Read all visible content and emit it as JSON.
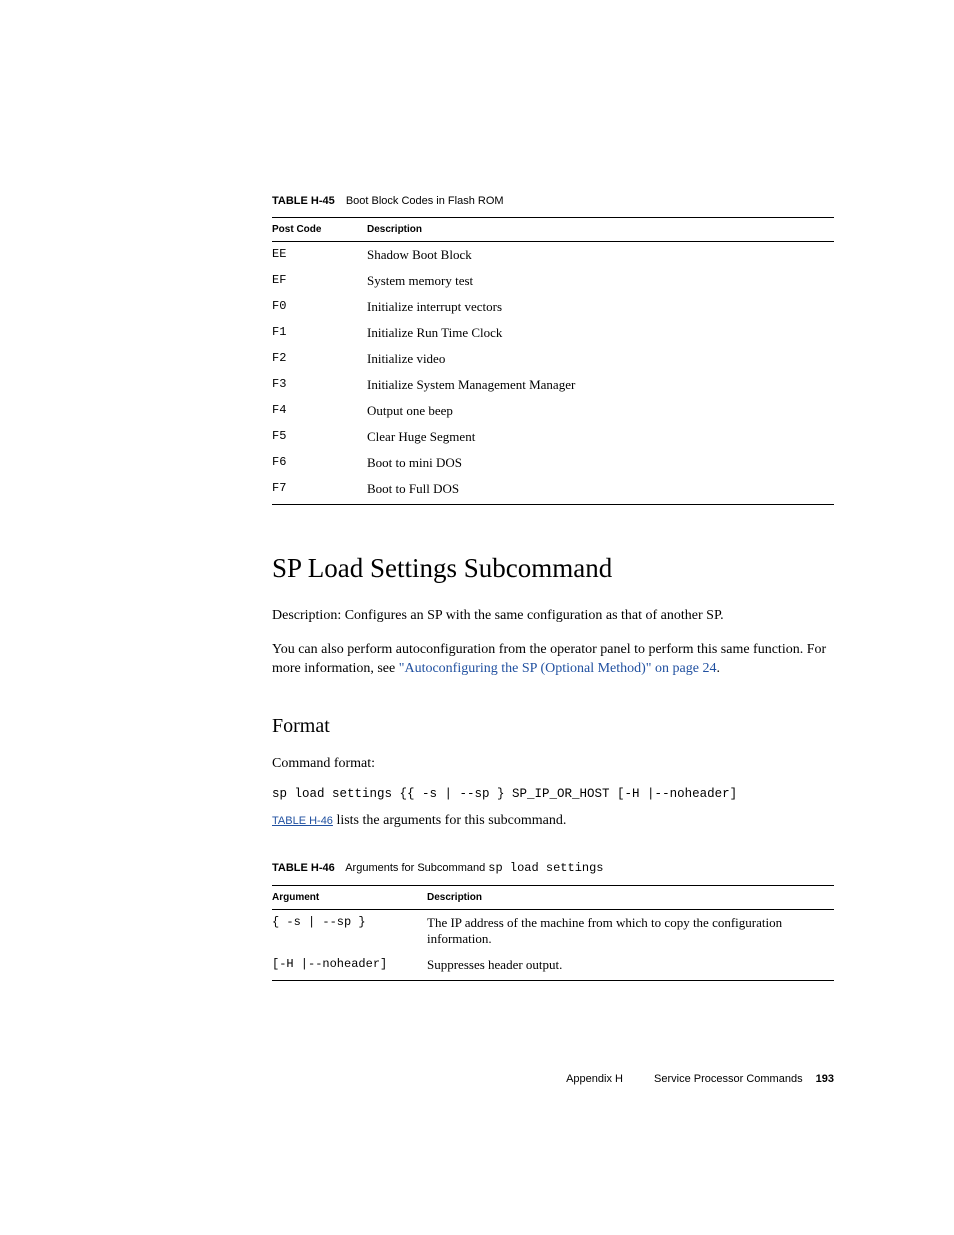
{
  "table1": {
    "label": "TABLE H-45",
    "title": "Boot Block Codes in Flash ROM",
    "headers": {
      "code": "Post Code",
      "desc": "Description"
    },
    "rows": [
      {
        "code": "EE",
        "desc": "Shadow Boot Block"
      },
      {
        "code": "EF",
        "desc": "System memory test"
      },
      {
        "code": "F0",
        "desc": "Initialize interrupt vectors"
      },
      {
        "code": "F1",
        "desc": "Initialize Run Time Clock"
      },
      {
        "code": "F2",
        "desc": "Initialize video"
      },
      {
        "code": "F3",
        "desc": "Initialize System Management Manager"
      },
      {
        "code": "F4",
        "desc": "Output one beep"
      },
      {
        "code": "F5",
        "desc": "Clear Huge Segment"
      },
      {
        "code": "F6",
        "desc": "Boot to mini DOS"
      },
      {
        "code": "F7",
        "desc": "Boot to Full DOS"
      }
    ]
  },
  "section": {
    "heading": "SP Load Settings Subcommand",
    "p1": "Description: Configures an SP with the same configuration as that of another SP.",
    "p2a": "You can also perform autoconfiguration from the operator panel to perform this same function. For more information, see ",
    "p2link": "\"Autoconfiguring the SP (Optional Method)\" on page 24",
    "p2b": "."
  },
  "format": {
    "heading": "Format",
    "p1": "Command format:",
    "cmd": "sp load settings {{ -s | --sp } SP_IP_OR_HOST [-H |--noheader]",
    "ref_link": "TABLE H-46",
    "ref_text": " lists the arguments for this subcommand."
  },
  "table2": {
    "label": "TABLE H-46",
    "title_a": "Arguments for Subcommand ",
    "title_mono": "sp load settings",
    "headers": {
      "arg": "Argument",
      "desc": "Description"
    },
    "rows": [
      {
        "arg": "{ -s | --sp }",
        "desc": "The IP address of the machine from which to copy the configuration information."
      },
      {
        "arg": "[-H |--noheader]",
        "desc": "Suppresses header output."
      }
    ]
  },
  "footer": {
    "appendix": "Appendix H",
    "title": "Service Processor Commands",
    "page": "193"
  }
}
